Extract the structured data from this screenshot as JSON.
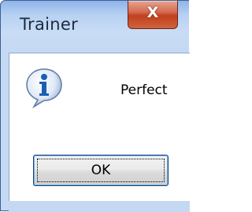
{
  "window": {
    "title": "Trainer",
    "close_glyph": "X"
  },
  "dialog": {
    "icon": "info-icon",
    "message": "Perfect"
  },
  "buttons": {
    "ok_label": "OK"
  },
  "colors": {
    "titlebar": "#b7d1f2",
    "close_button": "#c23f1d",
    "icon_blue": "#1a5fb4"
  }
}
